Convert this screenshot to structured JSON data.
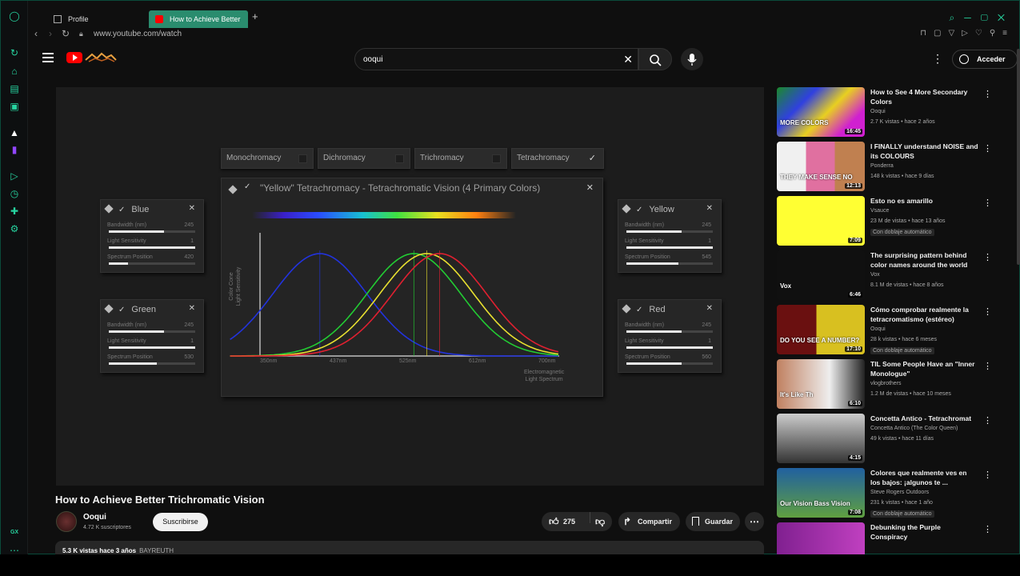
{
  "browser": {
    "tabs": [
      {
        "label": "Profile"
      },
      {
        "label": "How to Achieve Better"
      }
    ],
    "url": "www.youtube.com/watch",
    "sidebar_badge": "GX"
  },
  "header": {
    "search_value": "ooqui",
    "signin_label": "Acceder"
  },
  "player": {
    "modes": [
      {
        "label": "Monochromacy",
        "checked": false
      },
      {
        "label": "Dichromacy",
        "checked": false
      },
      {
        "label": "Trichromacy",
        "checked": false
      },
      {
        "label": "Tetrachromacy",
        "checked": true
      }
    ],
    "graph_title": "\"Yellow\" Tetrachromacy - Tetrachromatic Vision (4 Primary Colors)",
    "y_axis_label": "Color Cone\nLight Sensitivity",
    "x_axis_label": "Electromagnetic\nLight Spectrum",
    "x_ticks": [
      "350nm",
      "437nm",
      "525nm",
      "612nm",
      "700nm"
    ],
    "row_labels": [
      "Bandwidth (nm)",
      "Light Sensitivity",
      "Spectrum Position"
    ],
    "cones": [
      {
        "name": "Blue",
        "bandwidth": "245",
        "sensitivity": "1",
        "position": "420",
        "color": "#2233dd"
      },
      {
        "name": "Green",
        "bandwidth": "245",
        "sensitivity": "1",
        "position": "530",
        "color": "#22cc33"
      },
      {
        "name": "Yellow",
        "bandwidth": "245",
        "sensitivity": "1",
        "position": "545",
        "color": "#e8e030"
      },
      {
        "name": "Red",
        "bandwidth": "245",
        "sensitivity": "1",
        "position": "560",
        "color": "#e02030"
      }
    ]
  },
  "video": {
    "title": "How to Achieve Better Trichromatic Vision",
    "channel": "Ooqui",
    "subscribers": "4.72 K suscriptores",
    "subscribe_label": "Suscribirse",
    "likes": "275",
    "share_label": "Compartir",
    "save_label": "Guardar",
    "description_line": "5.3 K vistas  hace 3 años",
    "description_tag": "BAYREUTH"
  },
  "recommendations": [
    {
      "title": "How  to See 4 More Secondary Colors",
      "channel": "Ooqui",
      "meta": "2.7 K vistas • hace 2 años",
      "duration": "16:45",
      "badge": ""
    },
    {
      "title": "I FINALLY understand NOISE and its COLOURS",
      "channel": "Ponderra",
      "meta": "148 k vistas • hace 9 días",
      "duration": "12:13",
      "badge": ""
    },
    {
      "title": "Esto no es amarillo",
      "channel": "Vsauce",
      "meta": "23 M de vistas • hace 13 años",
      "duration": "7:09",
      "badge": "Con doblaje automático"
    },
    {
      "title": "The surprising pattern behind color names around the world",
      "channel": "Vox",
      "meta": "8.1 M de vistas • hace 8 años",
      "duration": "6:46",
      "badge": ""
    },
    {
      "title": "Cómo comprobar realmente la tetracromatismo (estéreo)",
      "channel": "Ooqui",
      "meta": "28 k vistas • hace 6 meses",
      "duration": "17:10",
      "badge": "Con doblaje automático"
    },
    {
      "title": "TIL Some People Have an \"Inner Monologue\"",
      "channel": "vlogbrothers",
      "meta": "1.2 M de vistas • hace 10 meses",
      "duration": "6:10",
      "badge": ""
    },
    {
      "title": "Concetta Antico - Tetrachromat",
      "channel": "Concetta Antico (The Color Queen)",
      "meta": "49 k vistas • hace 11 días",
      "duration": "4:15",
      "badge": ""
    },
    {
      "title": "Colores que realmente ves en los bajos: ¡algunos te ...",
      "channel": "Steve Rogers Outdoors",
      "meta": "231 k vistas • hace 1 año",
      "duration": "7:08",
      "badge": "Con doblaje automático"
    },
    {
      "title": "Debunking the Purple Conspiracy",
      "channel": "",
      "meta": "",
      "duration": "",
      "badge": ""
    }
  ],
  "thumb_texts": [
    "MORE COLORS",
    "THEY MAKE SENSE NO",
    "",
    "Vox",
    "DO YOU SEE A NUMBER?",
    "It's Like Th",
    "",
    "Our Vision  Bass Vision",
    ""
  ]
}
